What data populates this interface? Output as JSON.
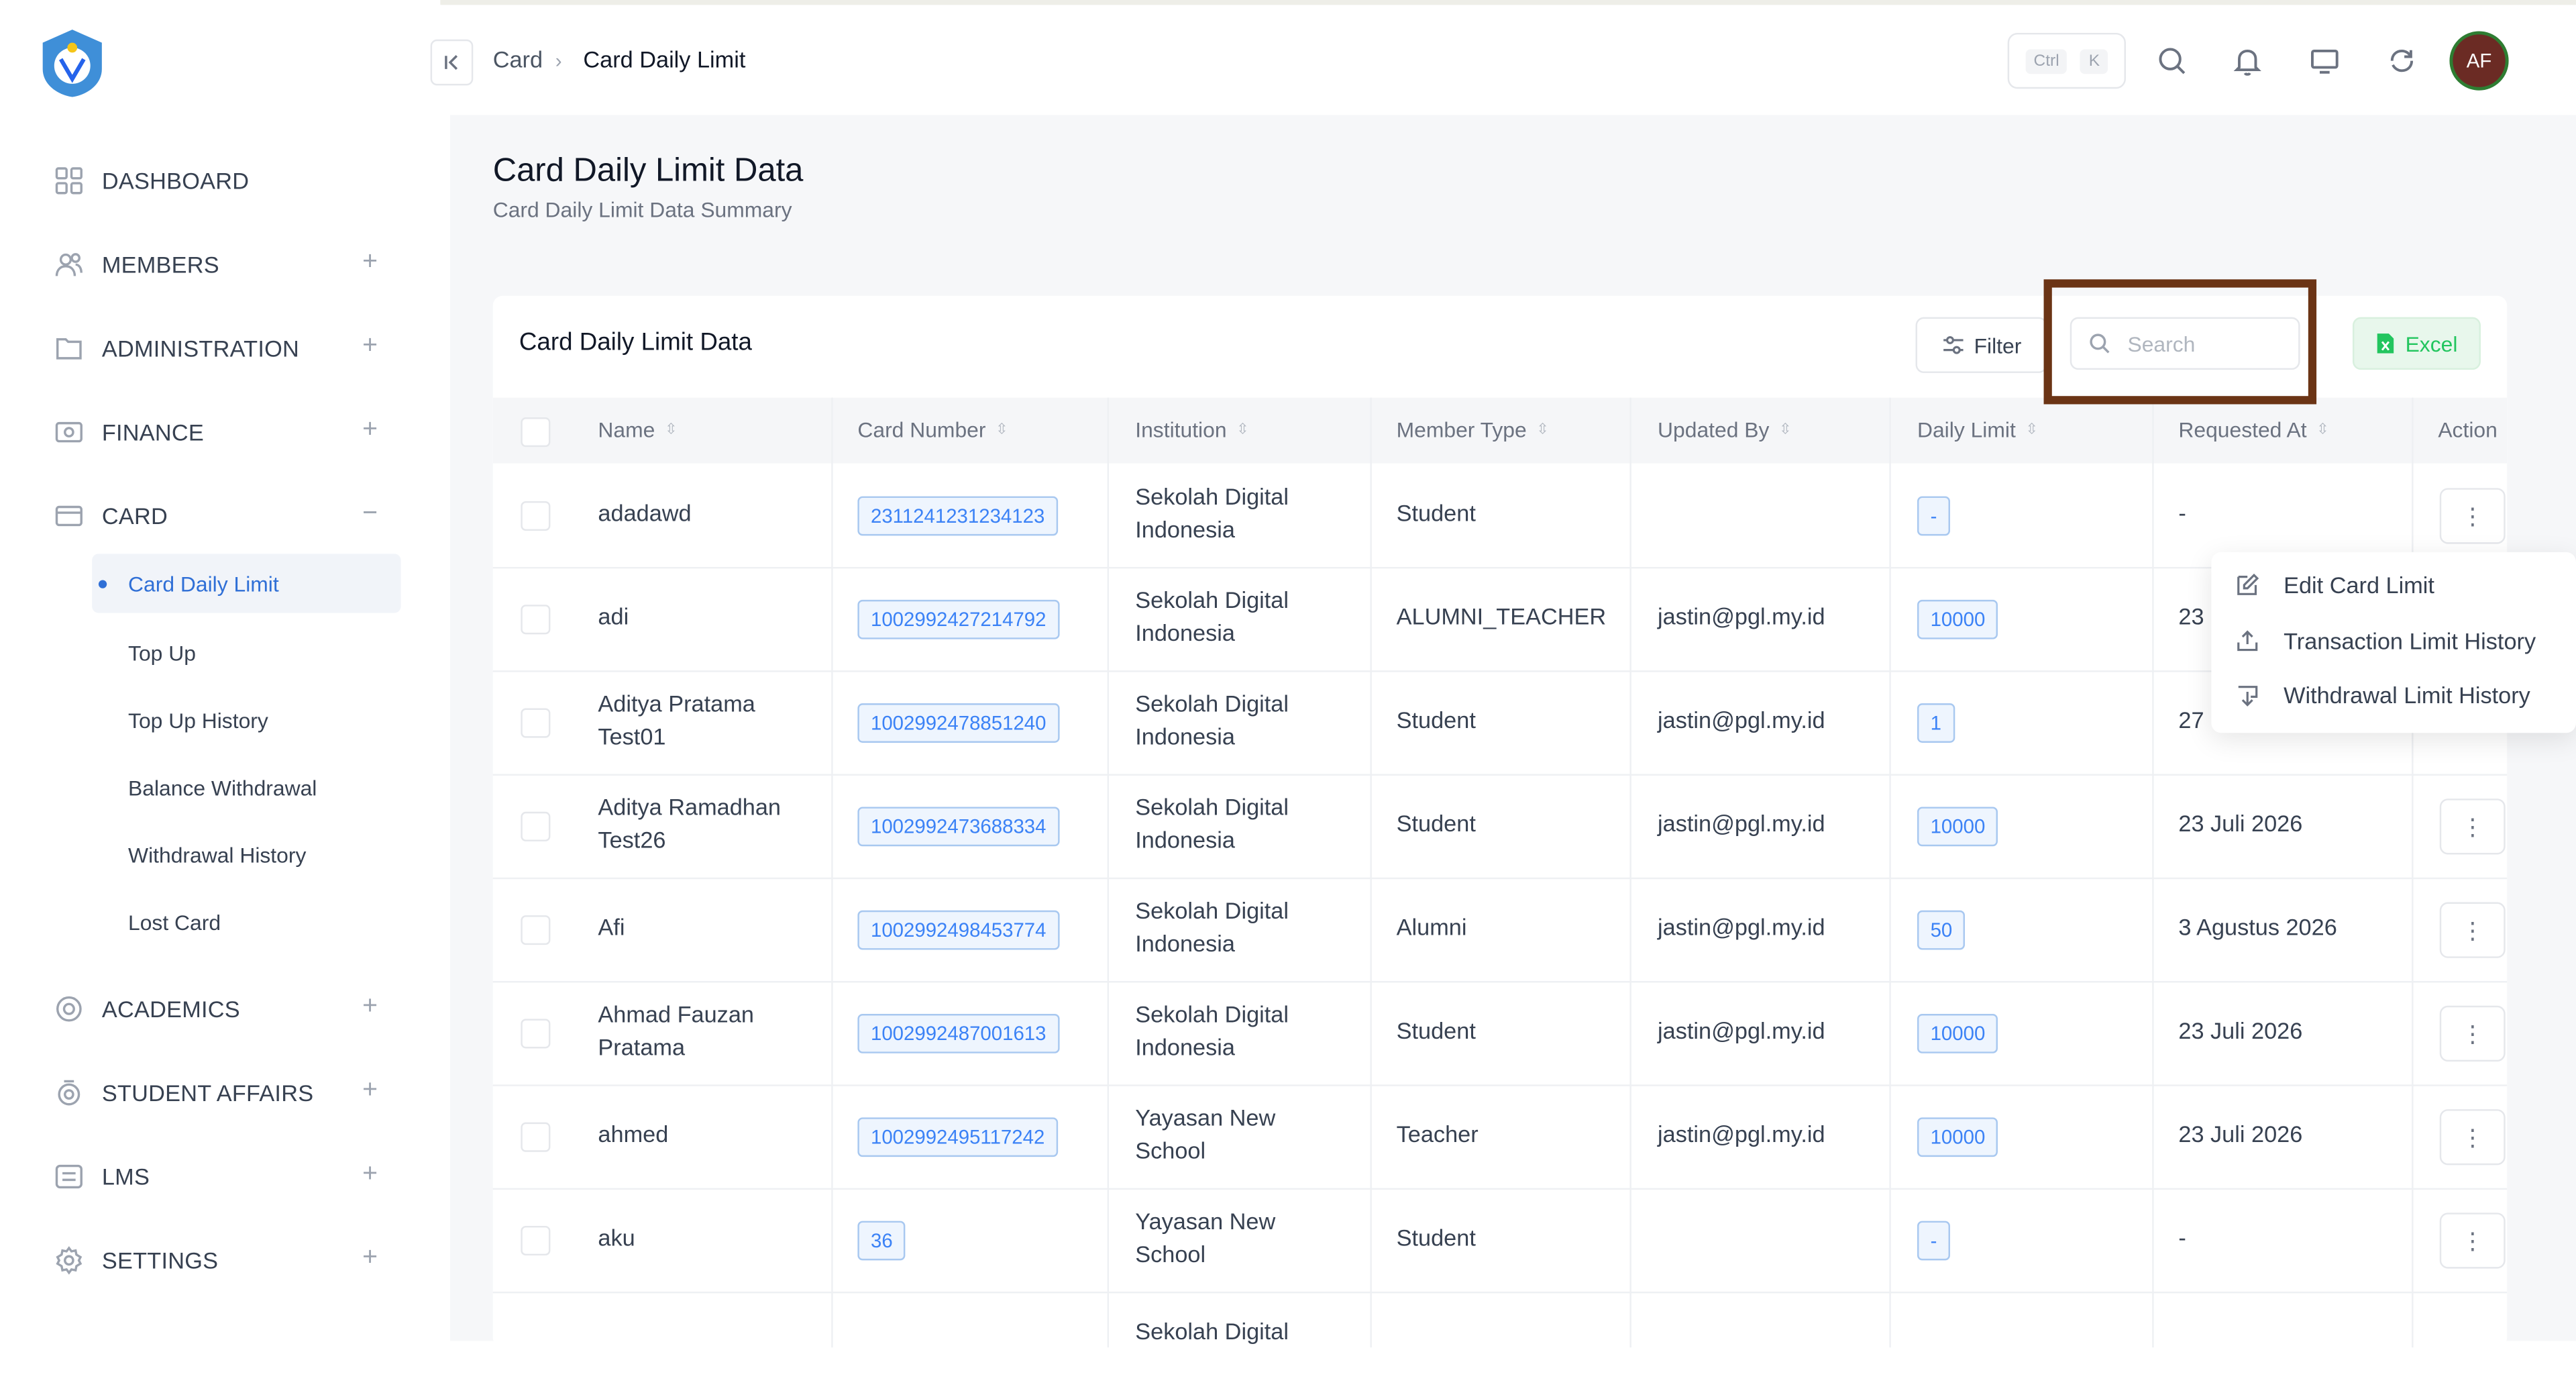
{
  "breadcrumb": {
    "parent": "Card",
    "current": "Card Daily Limit"
  },
  "topbar": {
    "kbd_ctrl": "Ctrl",
    "kbd_key": "K",
    "avatar_initials": "AF"
  },
  "sidebar": {
    "items": [
      {
        "label": "DASHBOARD",
        "icon": "grid-icon"
      },
      {
        "label": "MEMBERS",
        "icon": "users-icon"
      },
      {
        "label": "ADMINISTRATION",
        "icon": "folder-icon"
      },
      {
        "label": "FINANCE",
        "icon": "wallet-icon"
      },
      {
        "label": "CARD",
        "icon": "card-icon"
      },
      {
        "label": "ACADEMICS",
        "icon": "academics-icon"
      },
      {
        "label": "STUDENT AFFAIRS",
        "icon": "student-icon"
      },
      {
        "label": "LMS",
        "icon": "lms-icon"
      },
      {
        "label": "SETTINGS",
        "icon": "gear-icon"
      }
    ],
    "card_sub": [
      "Card Daily Limit",
      "Top Up",
      "Top Up History",
      "Balance Withdrawal",
      "Withdrawal History",
      "Lost Card"
    ]
  },
  "page": {
    "title": "Card Daily Limit Data",
    "subtitle": "Card Daily Limit Data Summary"
  },
  "card": {
    "title": "Card Daily Limit Data",
    "filter_label": "Filter",
    "search_placeholder": "Search",
    "excel_label": "Excel"
  },
  "table": {
    "columns": [
      "Name",
      "Card Number",
      "Institution",
      "Member Type",
      "Updated By",
      "Daily Limit",
      "Requested At",
      "Action"
    ],
    "rows": [
      {
        "name": "adadawd",
        "card": "2311241231234123",
        "inst": "Sekolah Digital Indonesia",
        "type": "Student",
        "by": "",
        "limit": "-",
        "req": "-"
      },
      {
        "name": "adi",
        "card": "1002992427214792",
        "inst": "Sekolah Digital Indonesia",
        "type": "ALUMNI_TEACHER",
        "by": "jastin@pgl.my.id",
        "limit": "10000",
        "req": "23"
      },
      {
        "name": "Aditya Pratama Test01",
        "card": "1002992478851240",
        "inst": "Sekolah Digital Indonesia",
        "type": "Student",
        "by": "jastin@pgl.my.id",
        "limit": "1",
        "req": "27"
      },
      {
        "name": "Aditya Ramadhan Test26",
        "card": "1002992473688334",
        "inst": "Sekolah Digital Indonesia",
        "type": "Student",
        "by": "jastin@pgl.my.id",
        "limit": "10000",
        "req": "23 Juli 2026"
      },
      {
        "name": "Afi",
        "card": "1002992498453774",
        "inst": "Sekolah Digital Indonesia",
        "type": "Alumni",
        "by": "jastin@pgl.my.id",
        "limit": "50",
        "req": "3 Agustus 2026"
      },
      {
        "name": "Ahmad Fauzan Pratama",
        "card": "1002992487001613",
        "inst": "Sekolah Digital Indonesia",
        "type": "Student",
        "by": "jastin@pgl.my.id",
        "limit": "10000",
        "req": "23 Juli 2026"
      },
      {
        "name": "ahmed",
        "card": "1002992495117242",
        "inst": "Yayasan New School",
        "type": "Teacher",
        "by": "jastin@pgl.my.id",
        "limit": "10000",
        "req": "23 Juli 2026"
      },
      {
        "name": "aku",
        "card": "36",
        "inst": "Yayasan New School",
        "type": "Student",
        "by": "",
        "limit": "-",
        "req": "-"
      },
      {
        "name": "",
        "card": "",
        "inst": "Sekolah Digital",
        "type": "",
        "by": "",
        "limit": "",
        "req": ""
      }
    ]
  },
  "menu": {
    "items": [
      "Edit Card Limit",
      "Transaction Limit History",
      "Withdrawal Limit History"
    ]
  }
}
